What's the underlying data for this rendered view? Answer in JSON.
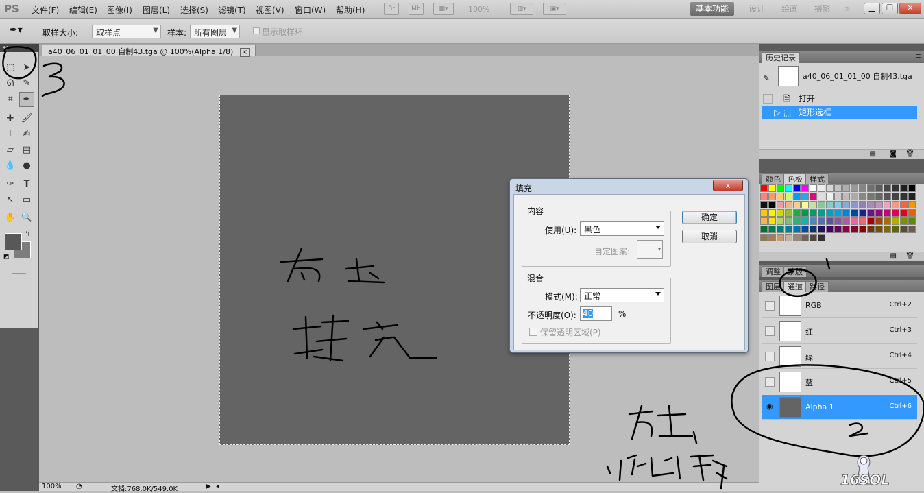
{
  "menubar": {
    "logo": "PS",
    "items": [
      "文件(F)",
      "编辑(E)",
      "图像(I)",
      "图层(L)",
      "选择(S)",
      "滤镜(T)",
      "视图(V)",
      "窗口(W)",
      "帮助(H)"
    ],
    "icons": [
      "Br",
      "Mb"
    ],
    "zoom": "100%",
    "workspaces": [
      "基本功能",
      "设计",
      "绘画",
      "摄影"
    ],
    "more": "»"
  },
  "options": {
    "sample_size_label": "取样大小:",
    "sample_size_value": "取样点",
    "sample_label": "样本:",
    "sample_value": "所有图层",
    "show_ring_label": "显示取样环"
  },
  "document": {
    "tab_title": "a40_06_01_01_00 自制43.tga @ 100%(Alpha 1/8)",
    "close": "×",
    "status_zoom": "100%",
    "status_doc": "文档:768.0K/549.0K"
  },
  "history": {
    "tab": "历史记录",
    "snapshot": "a40_06_01_01_00 自制43.tga",
    "items": [
      "打开",
      "矩形选框"
    ]
  },
  "color_panel": {
    "tabs": [
      "颜色",
      "色板",
      "样式"
    ]
  },
  "adjust_panel": {
    "tabs": [
      "调整",
      "蒙版"
    ]
  },
  "channels_panel": {
    "tabs": [
      "图层",
      "通道",
      "路径"
    ],
    "rows": [
      {
        "name": "RGB",
        "shortcut": "Ctrl+2"
      },
      {
        "name": "红",
        "shortcut": "Ctrl+3"
      },
      {
        "name": "绿",
        "shortcut": "Ctrl+4"
      },
      {
        "name": "蓝",
        "shortcut": "Ctrl+5"
      },
      {
        "name": "Alpha 1",
        "shortcut": "Ctrl+6"
      }
    ]
  },
  "fill_dialog": {
    "title": "填充",
    "close": "x",
    "contents_group": "内容",
    "use_label": "使用(U):",
    "use_value": "黑色",
    "custom_pattern_label": "自定图案:",
    "blend_group": "混合",
    "mode_label": "模式(M):",
    "mode_value": "正常",
    "opacity_label": "不透明度(O):",
    "opacity_value": "40",
    "percent": "%",
    "preserve_label": "保留透明区域(P)",
    "ok": "确定",
    "cancel": "取消"
  },
  "swatch_colors": [
    "#ff0000",
    "#ffff00",
    "#00ff00",
    "#00ffff",
    "#0000ff",
    "#ff00ff",
    "#ffffff",
    "#ebebeb",
    "#d6d6d6",
    "#c2c2c2",
    "#adadad",
    "#999999",
    "#858585",
    "#707070",
    "#5c5c5c",
    "#474747",
    "#333333",
    "#1f1f1f",
    "#000000",
    "#ff8080",
    "#ff9966",
    "#ffcc66",
    "#ccff66",
    "#00a0e9",
    "#2ea7e0",
    "#e4007f",
    "#dddddd",
    "#f0f0f0",
    "#cccccc",
    "#bbbbbb",
    "#aaaaaa",
    "#888888",
    "#777777",
    "#666666",
    "#555555",
    "#444444",
    "#333333",
    "#222222",
    "#111111",
    "#000000",
    "#f29c9f",
    "#f6b37f",
    "#facd89",
    "#fff799",
    "#cce198",
    "#89c997",
    "#84ccc9",
    "#7ecef4",
    "#88abda",
    "#8c97cb",
    "#8f82bc",
    "#aa89bd",
    "#c490bf",
    "#f19ec2",
    "#f29b87",
    "#ec6941",
    "#f39800",
    "#fcc800",
    "#fff100",
    "#cfdb00",
    "#8fc31f",
    "#22ac38",
    "#009944",
    "#009b6b",
    "#009e96",
    "#00a0c1",
    "#00a0e9",
    "#0086d1",
    "#00479d",
    "#1d2088",
    "#601986",
    "#920783",
    "#be0081",
    "#e5004f",
    "#e60012",
    "#eb6100",
    "#f8b551",
    "#ffe100",
    "#b3d465",
    "#80c269",
    "#32b16c",
    "#13b5b1",
    "#448aca",
    "#556fb5",
    "#5f52a0",
    "#8957a1",
    "#ae5da1",
    "#ea68a2",
    "#eb6877",
    "#a40000",
    "#a84200",
    "#ac6a00",
    "#b7aa00",
    "#7f8f00",
    "#5b8c00",
    "#007130",
    "#007a4d",
    "#007d76",
    "#007e95",
    "#0075a9",
    "#004da0",
    "#00357a",
    "#1b1464",
    "#440062",
    "#6a005f",
    "#8f0044",
    "#840031",
    "#8a0000",
    "#6a3906",
    "#7d4a00",
    "#806a00",
    "#5e6a00",
    "#594c3c",
    "#6d5c4a",
    "#8c7853",
    "#a67c52",
    "#c69c6d",
    "#c7b299",
    "#998675",
    "#736357",
    "#534741",
    "#362f2d"
  ]
}
